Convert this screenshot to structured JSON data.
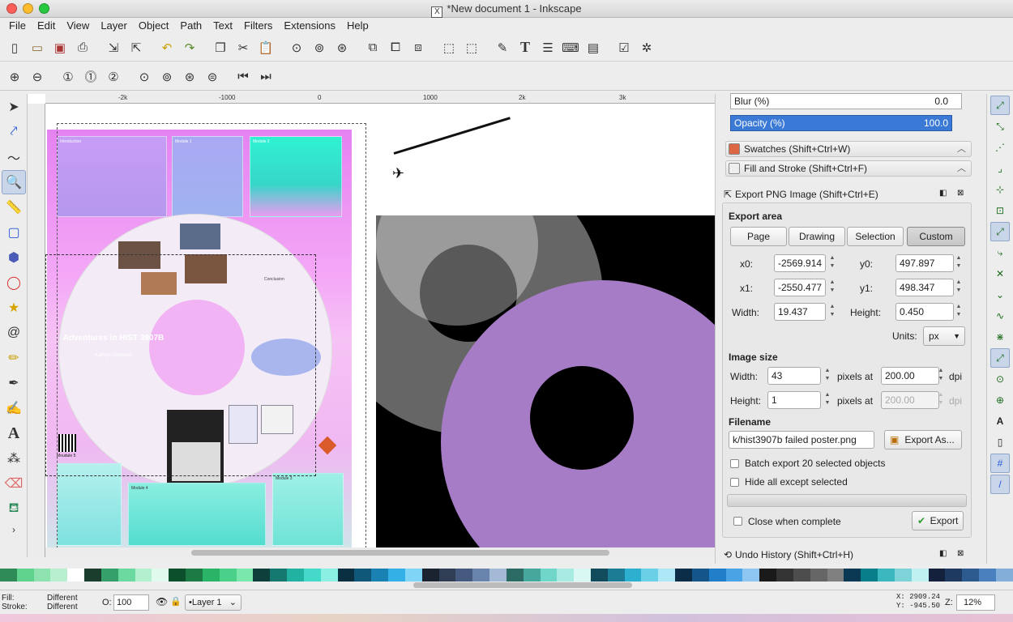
{
  "window": {
    "title": "*New document 1 - Inkscape"
  },
  "menu": [
    "File",
    "Edit",
    "View",
    "Layer",
    "Object",
    "Path",
    "Text",
    "Filters",
    "Extensions",
    "Help"
  ],
  "command_icons": [
    "new-icon",
    "open-icon",
    "save-icon",
    "print-icon",
    "import-icon",
    "export-icon",
    "undo-icon",
    "redo-icon",
    "copy-icon",
    "cut-icon",
    "paste-icon",
    "zoom-selection-icon",
    "zoom-drawing-icon",
    "zoom-page-icon",
    "duplicate-icon",
    "clone-icon",
    "unlink-clone-icon",
    "group-icon",
    "ungroup-icon",
    "fill-stroke-icon",
    "text-font-icon",
    "layers-icon",
    "xml-editor-icon",
    "align-icon",
    "document-properties-icon",
    "preferences-icon"
  ],
  "ruler": {
    "top": [
      "-2k",
      "-1000",
      "0",
      "1000",
      "2k",
      "3k"
    ]
  },
  "poster": {
    "introduction": "Introduction",
    "module1": "Module 1",
    "module2": "Module 2",
    "conclusion": "Conclusion",
    "title": "Adventures in HIST 3907B",
    "author": "Kathryn Greenan",
    "module5": "Moudule 5",
    "module4": "Module 4",
    "module3": "Module 3"
  },
  "dock": {
    "blur_label": "Blur (%)",
    "blur_value": "0.0",
    "opacity_label": "Opacity (%)",
    "opacity_value": "100.0",
    "swatches": "Swatches (Shift+Ctrl+W)",
    "fill_stroke": "Fill and Stroke (Shift+Ctrl+F)",
    "export_title": "Export PNG Image (Shift+Ctrl+E)",
    "export_area": "Export area",
    "area_buttons": [
      "Page",
      "Drawing",
      "Selection",
      "Custom"
    ],
    "x0_label": "x0:",
    "x0": "-2569.914",
    "y0_label": "y0:",
    "y0": "497.897",
    "x1_label": "x1:",
    "x1": "-2550.477",
    "y1_label": "y1:",
    "y1": "498.347",
    "width_label": "Width:",
    "width": "19.437",
    "height_label": "Height:",
    "height": "0.450",
    "units_label": "Units:",
    "units": "px",
    "image_size": "Image size",
    "img_width_label": "Width:",
    "img_width": "43",
    "img_height_label": "Height:",
    "img_height": "1",
    "pixels_at": "pixels at",
    "dpi_value": "200.00",
    "dpi_value2": "200.00",
    "dpi": "dpi",
    "filename_label": "Filename",
    "filename": "k/hist3907b failed poster.png",
    "export_as": "Export As...",
    "batch": "Batch export 20 selected objects",
    "hide_all": "Hide all except selected",
    "close_when": "Close when complete",
    "export": "Export",
    "undo_history": "Undo History (Shift+Ctrl+H)"
  },
  "palette_colors": [
    "#2e8b57",
    "#5fd38d",
    "#8de2b0",
    "#b7efd0",
    "#ffffff",
    "#1a3d2e",
    "#35a06a",
    "#6cd9a1",
    "#b2f0cf",
    "#e0fbee",
    "#0b4f2c",
    "#1c7a45",
    "#2ab468",
    "#4bd08a",
    "#7ae7ac",
    "#0f3f3a",
    "#16796f",
    "#21b2a2",
    "#44d9c8",
    "#8cefe3",
    "#0a2f40",
    "#10587a",
    "#1a82b3",
    "#33b1e6",
    "#80d4f5",
    "#1b2330",
    "#2f3d55",
    "#455a7e",
    "#6a85ad",
    "#a4b9d6",
    "#2b6b63",
    "#46a89c",
    "#70d6c9",
    "#a8ebe2",
    "#d9f8f3",
    "#124c5c",
    "#1d7c95",
    "#2db0cf",
    "#6ad0e8",
    "#aee7f5",
    "#0c2d48",
    "#15568a",
    "#217ec9",
    "#4aa3e5",
    "#8dc6f0",
    "#1a1a1a",
    "#333333",
    "#4d4d4d",
    "#666666",
    "#808080",
    "#0b3954",
    "#087e8b",
    "#3ab7bf",
    "#7dd3d8",
    "#bff0f2",
    "#14213d",
    "#1f3a60",
    "#2d5a8f",
    "#4a80bd",
    "#83aed9"
  ],
  "status": {
    "fill_label": "Fill:",
    "fill_value": "Different",
    "stroke_label": "Stroke:",
    "stroke_value": "Different",
    "opacity_label": "O:",
    "opacity_value": "100",
    "layer": "•Layer 1",
    "x_coord": "X: 2909.24",
    "y_coord": "Y: -945.50",
    "zoom_label": "Z:",
    "zoom": "12%"
  }
}
